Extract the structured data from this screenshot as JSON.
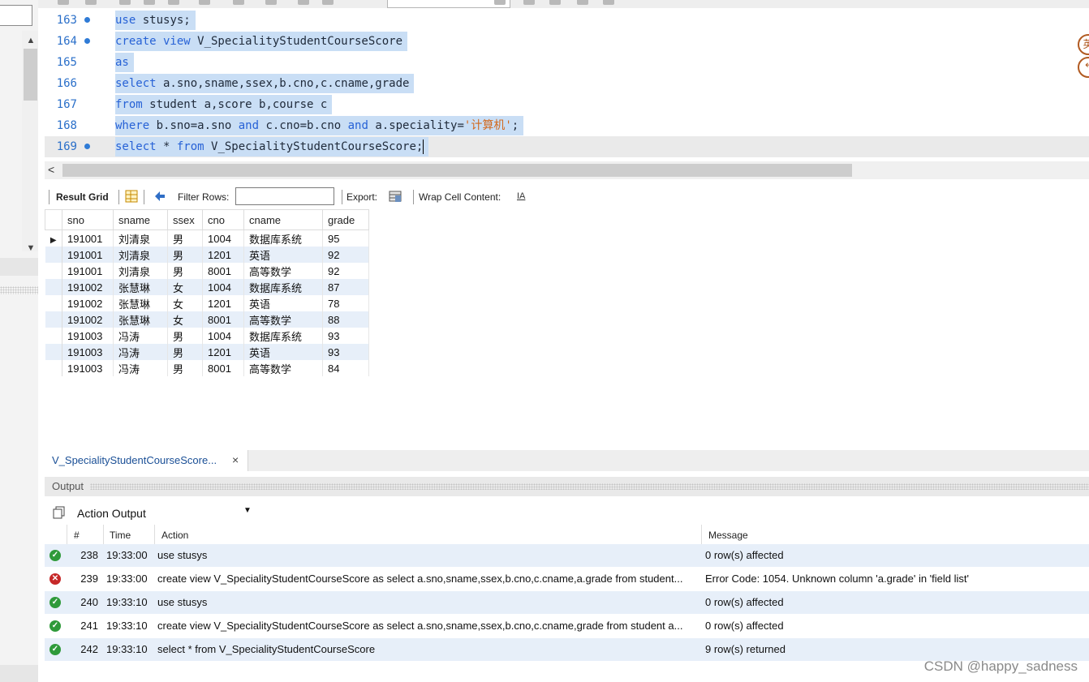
{
  "editor": {
    "lines": [
      {
        "number": "163",
        "marker": true,
        "tokens": [
          [
            "kw",
            "use"
          ],
          [
            "plain",
            " stusys;"
          ]
        ]
      },
      {
        "number": "164",
        "marker": true,
        "tokens": [
          [
            "kw",
            "create view"
          ],
          [
            "plain",
            " V_SpecialityStudentCourseScore"
          ]
        ]
      },
      {
        "number": "165",
        "marker": false,
        "tokens": [
          [
            "kw",
            "as"
          ]
        ]
      },
      {
        "number": "166",
        "marker": false,
        "tokens": [
          [
            "kw",
            "select"
          ],
          [
            "plain",
            " a.sno,sname,ssex,b.cno,c.cname,grade"
          ]
        ]
      },
      {
        "number": "167",
        "marker": false,
        "tokens": [
          [
            "kw",
            "from"
          ],
          [
            "plain",
            " student a,score b,course c"
          ]
        ]
      },
      {
        "number": "168",
        "marker": false,
        "tokens": [
          [
            "kw",
            "where"
          ],
          [
            "plain",
            " b.sno=a.sno "
          ],
          [
            "kw",
            "and"
          ],
          [
            "plain",
            " c.cno=b.cno "
          ],
          [
            "kw",
            "and"
          ],
          [
            "plain",
            " a.speciality="
          ],
          [
            "str",
            "'计算机'"
          ],
          [
            "plain",
            ";"
          ]
        ]
      },
      {
        "number": "169",
        "marker": true,
        "current": true,
        "tokens": [
          [
            "kw",
            "select"
          ],
          [
            "plain",
            " * "
          ],
          [
            "kw",
            "from"
          ],
          [
            "plain",
            " V_SpecialityStudentCourseScore;"
          ]
        ]
      }
    ],
    "badge_top": "英",
    "badge_bottom": "↰"
  },
  "result_toolbar": {
    "result_grid_label": "Result Grid",
    "filter_rows_label": "Filter Rows:",
    "filter_value": "",
    "export_label": "Export:",
    "wrap_label": "Wrap Cell Content:",
    "wrap_icon_text": "IA"
  },
  "result_grid": {
    "columns": [
      "sno",
      "sname",
      "ssex",
      "cno",
      "cname",
      "grade"
    ],
    "rows": [
      [
        "191001",
        "刘清泉",
        "男",
        "1004",
        "数据库系统",
        "95"
      ],
      [
        "191001",
        "刘清泉",
        "男",
        "1201",
        "英语",
        "92"
      ],
      [
        "191001",
        "刘清泉",
        "男",
        "8001",
        "高等数学",
        "92"
      ],
      [
        "191002",
        "张慧琳",
        "女",
        "1004",
        "数据库系统",
        "87"
      ],
      [
        "191002",
        "张慧琳",
        "女",
        "1201",
        "英语",
        "78"
      ],
      [
        "191002",
        "张慧琳",
        "女",
        "8001",
        "高等数学",
        "88"
      ],
      [
        "191003",
        "冯涛",
        "男",
        "1004",
        "数据库系统",
        "93"
      ],
      [
        "191003",
        "冯涛",
        "男",
        "1201",
        "英语",
        "93"
      ],
      [
        "191003",
        "冯涛",
        "男",
        "8001",
        "高等数学",
        "84"
      ]
    ]
  },
  "result_tab": {
    "label": "V_SpecialityStudentCourseScore...",
    "close": "×"
  },
  "output": {
    "title": "Output",
    "selector_value": "Action Output",
    "columns": {
      "num": "#",
      "time": "Time",
      "action": "Action",
      "message": "Message"
    },
    "rows": [
      {
        "status": "ok",
        "num": "238",
        "time": "19:33:00",
        "action": "use stusys",
        "message": "0 row(s) affected"
      },
      {
        "status": "err",
        "num": "239",
        "time": "19:33:00",
        "action": "create view V_SpecialityStudentCourseScore as select a.sno,sname,ssex,b.cno,c.cname,a.grade from student...",
        "message": "Error Code: 1054. Unknown column 'a.grade' in 'field list'"
      },
      {
        "status": "ok",
        "num": "240",
        "time": "19:33:10",
        "action": "use stusys",
        "message": "0 row(s) affected"
      },
      {
        "status": "ok",
        "num": "241",
        "time": "19:33:10",
        "action": "create view V_SpecialityStudentCourseScore as select a.sno,sname,ssex,b.cno,c.cname,grade from student a...",
        "message": "0 row(s) affected"
      },
      {
        "status": "ok",
        "num": "242",
        "time": "19:33:10",
        "action": "select * from V_SpecialityStudentCourseScore",
        "message": "9 row(s) returned"
      }
    ]
  },
  "watermark": "CSDN @happy_sadness",
  "colors": {
    "keyword": "#2762d6",
    "string": "#d2691e",
    "line_number": "#2a6fc9",
    "selection": "#c9def5",
    "ok": "#2f9a3a",
    "error": "#c62828"
  }
}
